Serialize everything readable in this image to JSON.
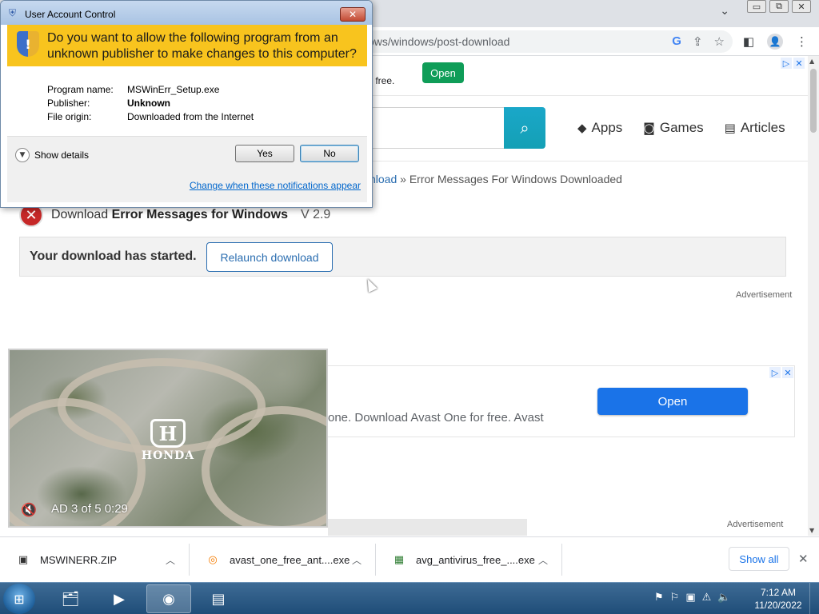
{
  "browser": {
    "url": "ows/windows/post-download",
    "window_controls": [
      "▭",
      "⧉",
      "✕"
    ],
    "omnibox_icons": [
      "G",
      "⇪",
      "☆"
    ],
    "toolbar_icons": [
      "◧",
      "👤",
      "⋮"
    ]
  },
  "top_ad": {
    "text": "r free.",
    "button": "Open"
  },
  "site": {
    "nav": [
      {
        "icon": "apps-icon",
        "label": "Apps"
      },
      {
        "icon": "gamepad-icon",
        "label": "Games"
      },
      {
        "icon": "articles-icon",
        "label": "Articles"
      }
    ],
    "breadcrumb_link": "nload",
    "breadcrumb_sep": " » ",
    "breadcrumb_current": "Error Messages For Windows Downloaded",
    "title_prefix": "Download ",
    "title_app": "Error Messages for Windows",
    "version": "V 2.9",
    "download_started": "Your download has started.",
    "relaunch": "Relaunch download",
    "ad_label_1": "Advertisement",
    "ad_label_2": "Advertisement"
  },
  "ad2": {
    "text": "one. Download Avast One for free. Avast",
    "button": "Open"
  },
  "video_ad": {
    "brand": "HONDA",
    "counter": "AD 3 of 5  0:29"
  },
  "uac": {
    "title": "User Account Control",
    "question": "Do you want to allow the following program from an unknown publisher to make changes to this computer?",
    "rows": [
      {
        "key": "Program name:",
        "value": "MSWinErr_Setup.exe"
      },
      {
        "key": "Publisher:",
        "value": "Unknown"
      },
      {
        "key": "File origin:",
        "value": "Downloaded from the Internet"
      }
    ],
    "show_details": "Show details",
    "yes": "Yes",
    "no": "No",
    "link": "Change when these notifications appear"
  },
  "downloads": {
    "items": [
      {
        "icon": "zip-file-icon",
        "name": "MSWINERR.ZIP"
      },
      {
        "icon": "avast-icon",
        "name": "avast_one_free_ant....exe"
      },
      {
        "icon": "avg-icon",
        "name": "avg_antivirus_free_....exe"
      }
    ],
    "show_all": "Show all"
  },
  "taskbar": {
    "time": "7:12 AM",
    "date": "11/20/2022",
    "apps": [
      "explorer-icon",
      "media-player-icon",
      "chrome-icon",
      "installer-icon"
    ]
  },
  "colors": {
    "uac_banner": "#f8c41e",
    "search_button": "#17a2b8",
    "ad_open_blue": "#1a73e8",
    "top_ad_green": "#0f9d58",
    "taskbar": "#1f4d78"
  }
}
